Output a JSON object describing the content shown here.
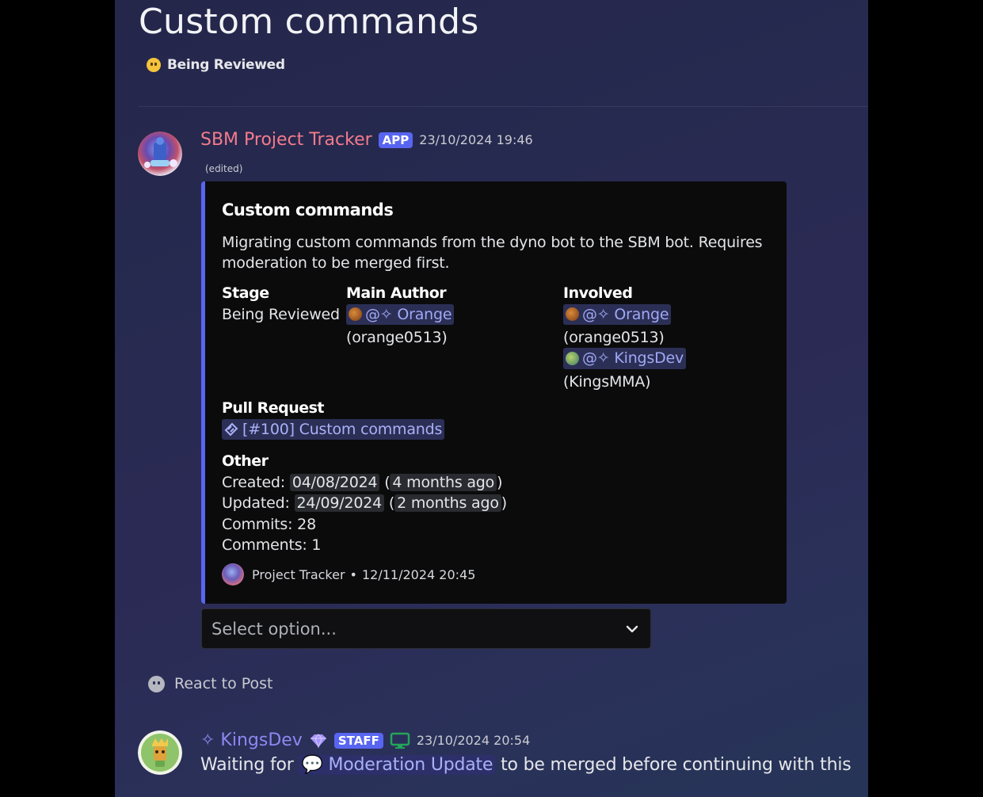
{
  "post": {
    "title": "Custom commands",
    "tag_label": "Being Reviewed"
  },
  "message1": {
    "author": "SBM Project Tracker",
    "badge": "APP",
    "timestamp": "23/10/2024 19:46",
    "edited": "(edited)",
    "embed": {
      "title": "Custom commands",
      "description": "Migrating custom commands from the dyno bot to the SBM bot. Requires moderation to be merged first.",
      "stage": {
        "name": "Stage",
        "value": "Being Reviewed"
      },
      "main_author": {
        "name": "Main Author",
        "mention": "@✧ Orange",
        "handle": "(orange0513)"
      },
      "involved": {
        "name": "Involved",
        "people": [
          {
            "mention": "@✧ Orange",
            "handle": "(orange0513)"
          },
          {
            "mention": "@✧ KingsDev",
            "handle": "(KingsMMA)"
          }
        ]
      },
      "pull_request": {
        "name": "Pull Request",
        "link": "[#100] Custom commands"
      },
      "other": {
        "name": "Other",
        "created_label": "Created:",
        "created_date": "04/08/2024",
        "created_ago": "4 months ago",
        "updated_label": "Updated:",
        "updated_date": "24/09/2024",
        "updated_ago": "2 months ago",
        "commits": "Commits: 28",
        "comments": "Comments: 1"
      },
      "footer": {
        "text": "Project Tracker",
        "separator": "•",
        "time": "12/11/2024 20:45"
      }
    },
    "select_placeholder": "Select option..."
  },
  "react_label": "React to Post",
  "message2": {
    "author": "✧ KingsDev",
    "badge": "STAFF",
    "timestamp": "23/10/2024 20:54",
    "text_before": "Waiting for",
    "channel_mention": "Moderation Update",
    "text_after": "to be merged before continuing with this"
  },
  "colors": {
    "accent": "#5865f2",
    "bot_name": "#f47b8d",
    "user_name": "#8f86f2",
    "embed_bg": "#0b0b0c",
    "mention_bg": "#2c2f55"
  },
  "icons": [
    "sbm-avatar",
    "kingsdev-avatar",
    "reviewing-emoji",
    "github-pr-icon",
    "chevron-down-icon",
    "smiley-icon",
    "nitro-gem-icon",
    "desktop-icon",
    "thread-bubble-icon"
  ]
}
